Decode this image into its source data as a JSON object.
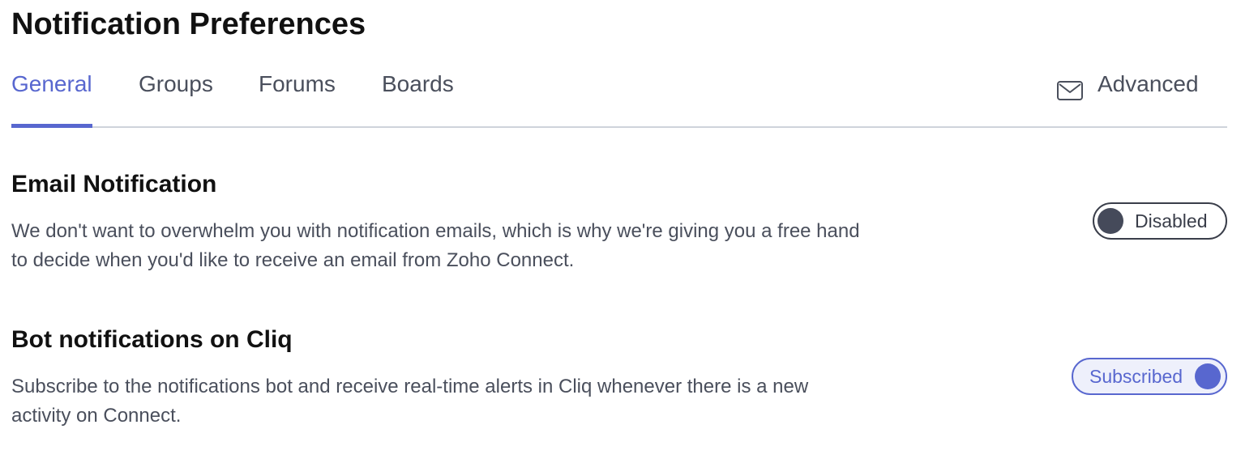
{
  "page": {
    "title": "Notification Preferences"
  },
  "tabs": {
    "items": [
      {
        "label": "General",
        "active": true
      },
      {
        "label": "Groups",
        "active": false
      },
      {
        "label": "Forums",
        "active": false
      },
      {
        "label": "Boards",
        "active": false
      }
    ],
    "advanced": {
      "label": "Advanced",
      "icon": "mail-icon"
    }
  },
  "email_notification": {
    "title": "Email Notification",
    "description": "We don't want to overwhelm you with notification emails, which is why we're giving you a free hand to decide when you'd like to receive an email from Zoho Connect.",
    "toggle_label": "Disabled",
    "enabled": false
  },
  "bot_notification": {
    "title": "Bot notifications on Cliq",
    "description": "Subscribe to the notifications bot and receive real-time alerts in Cliq whenever there is a new activity on Connect.",
    "toggle_label": "Subscribed",
    "enabled": true
  },
  "colors": {
    "accent": "#5867cf",
    "text_primary": "#111111",
    "text_secondary": "#4a4f5c",
    "divider": "#cfd3db",
    "toggle_off": "#454a5a",
    "toggle_on_bg": "#eef0fb"
  }
}
